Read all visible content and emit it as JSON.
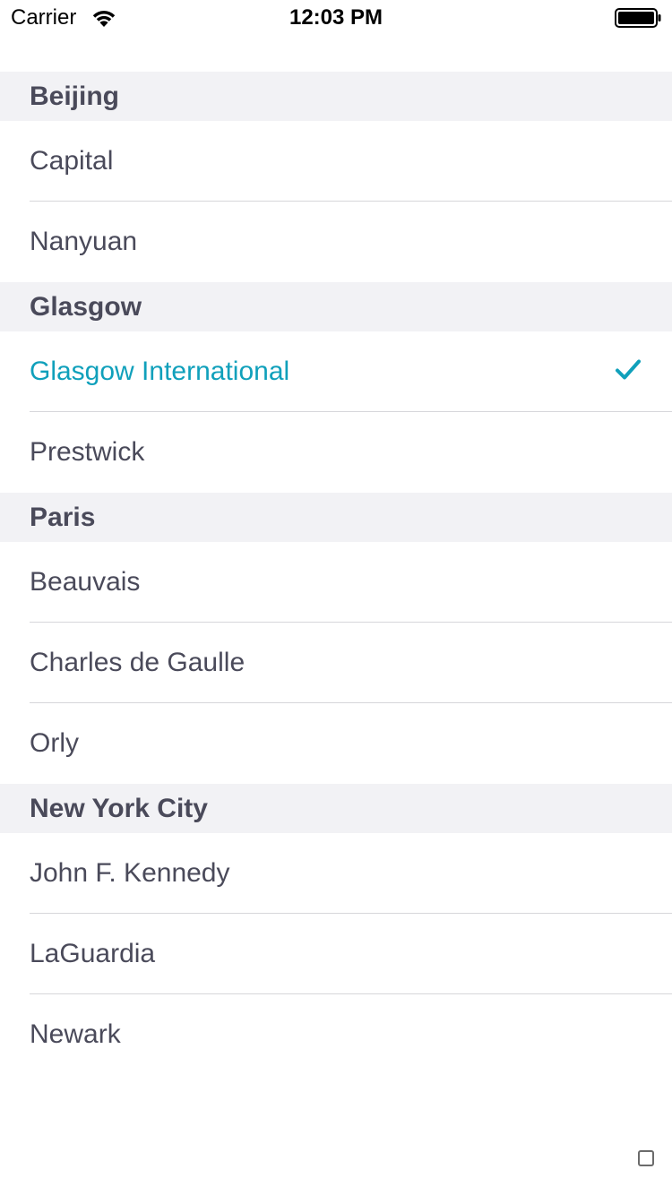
{
  "status_bar": {
    "carrier": "Carrier",
    "time": "12:03 PM",
    "wifi_icon": "wifi-icon",
    "battery_icon": "battery-icon"
  },
  "accent_color": "#10a0bb",
  "sections": [
    {
      "title": "Beijing",
      "items": [
        {
          "label": "Capital",
          "selected": false
        },
        {
          "label": "Nanyuan",
          "selected": false
        }
      ]
    },
    {
      "title": "Glasgow",
      "items": [
        {
          "label": "Glasgow International",
          "selected": true
        },
        {
          "label": "Prestwick",
          "selected": false
        }
      ]
    },
    {
      "title": "Paris",
      "items": [
        {
          "label": "Beauvais",
          "selected": false
        },
        {
          "label": "Charles de Gaulle",
          "selected": false
        },
        {
          "label": "Orly",
          "selected": false
        }
      ]
    },
    {
      "title": "New York City",
      "items": [
        {
          "label": "John F. Kennedy",
          "selected": false
        },
        {
          "label": "LaGuardia",
          "selected": false
        },
        {
          "label": "Newark",
          "selected": false
        }
      ]
    }
  ]
}
